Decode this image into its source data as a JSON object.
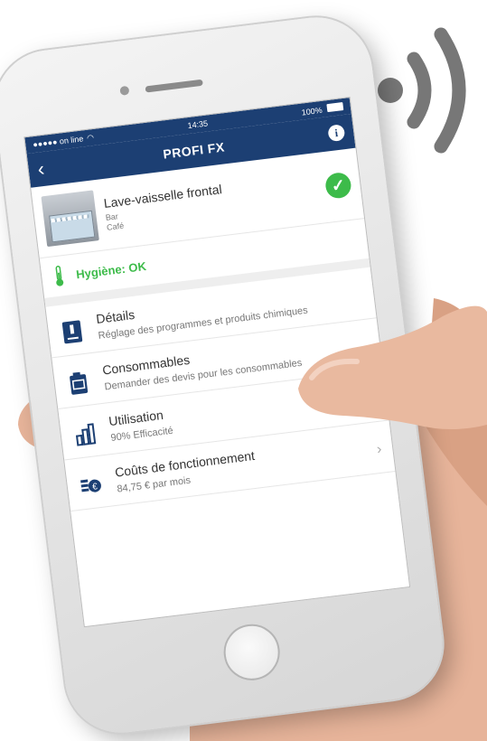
{
  "status_bar": {
    "carrier": "●●●●● on line",
    "time": "14:35",
    "battery": "100%"
  },
  "nav": {
    "back_icon": "chevron-left-icon",
    "title": "PROFI FX",
    "info_icon": "info-icon",
    "accent": "#1c3f73"
  },
  "device": {
    "name": "Lave-vaisselle frontal",
    "line1": "Bar",
    "line2": "Café",
    "status_icon": "check-circle-icon",
    "status_color": "#3dbb4a"
  },
  "hygiene": {
    "label": "Hygiène: OK",
    "icon": "thermometer-icon"
  },
  "menu": [
    {
      "title": "Détails",
      "subtitle": "Réglage des programmes et produits chimiques",
      "icon": "document-icon"
    },
    {
      "title": "Consommables",
      "subtitle": "Demander des devis pour les consommables",
      "icon": "canister-icon"
    },
    {
      "title": "Utilisation",
      "subtitle": "90% Efficacité",
      "icon": "usage-icon"
    },
    {
      "title": "Coûts de fonctionnement",
      "subtitle": "84,75 € par mois",
      "icon": "euro-icon"
    }
  ],
  "signal_icon": "wireless-signal-icon"
}
